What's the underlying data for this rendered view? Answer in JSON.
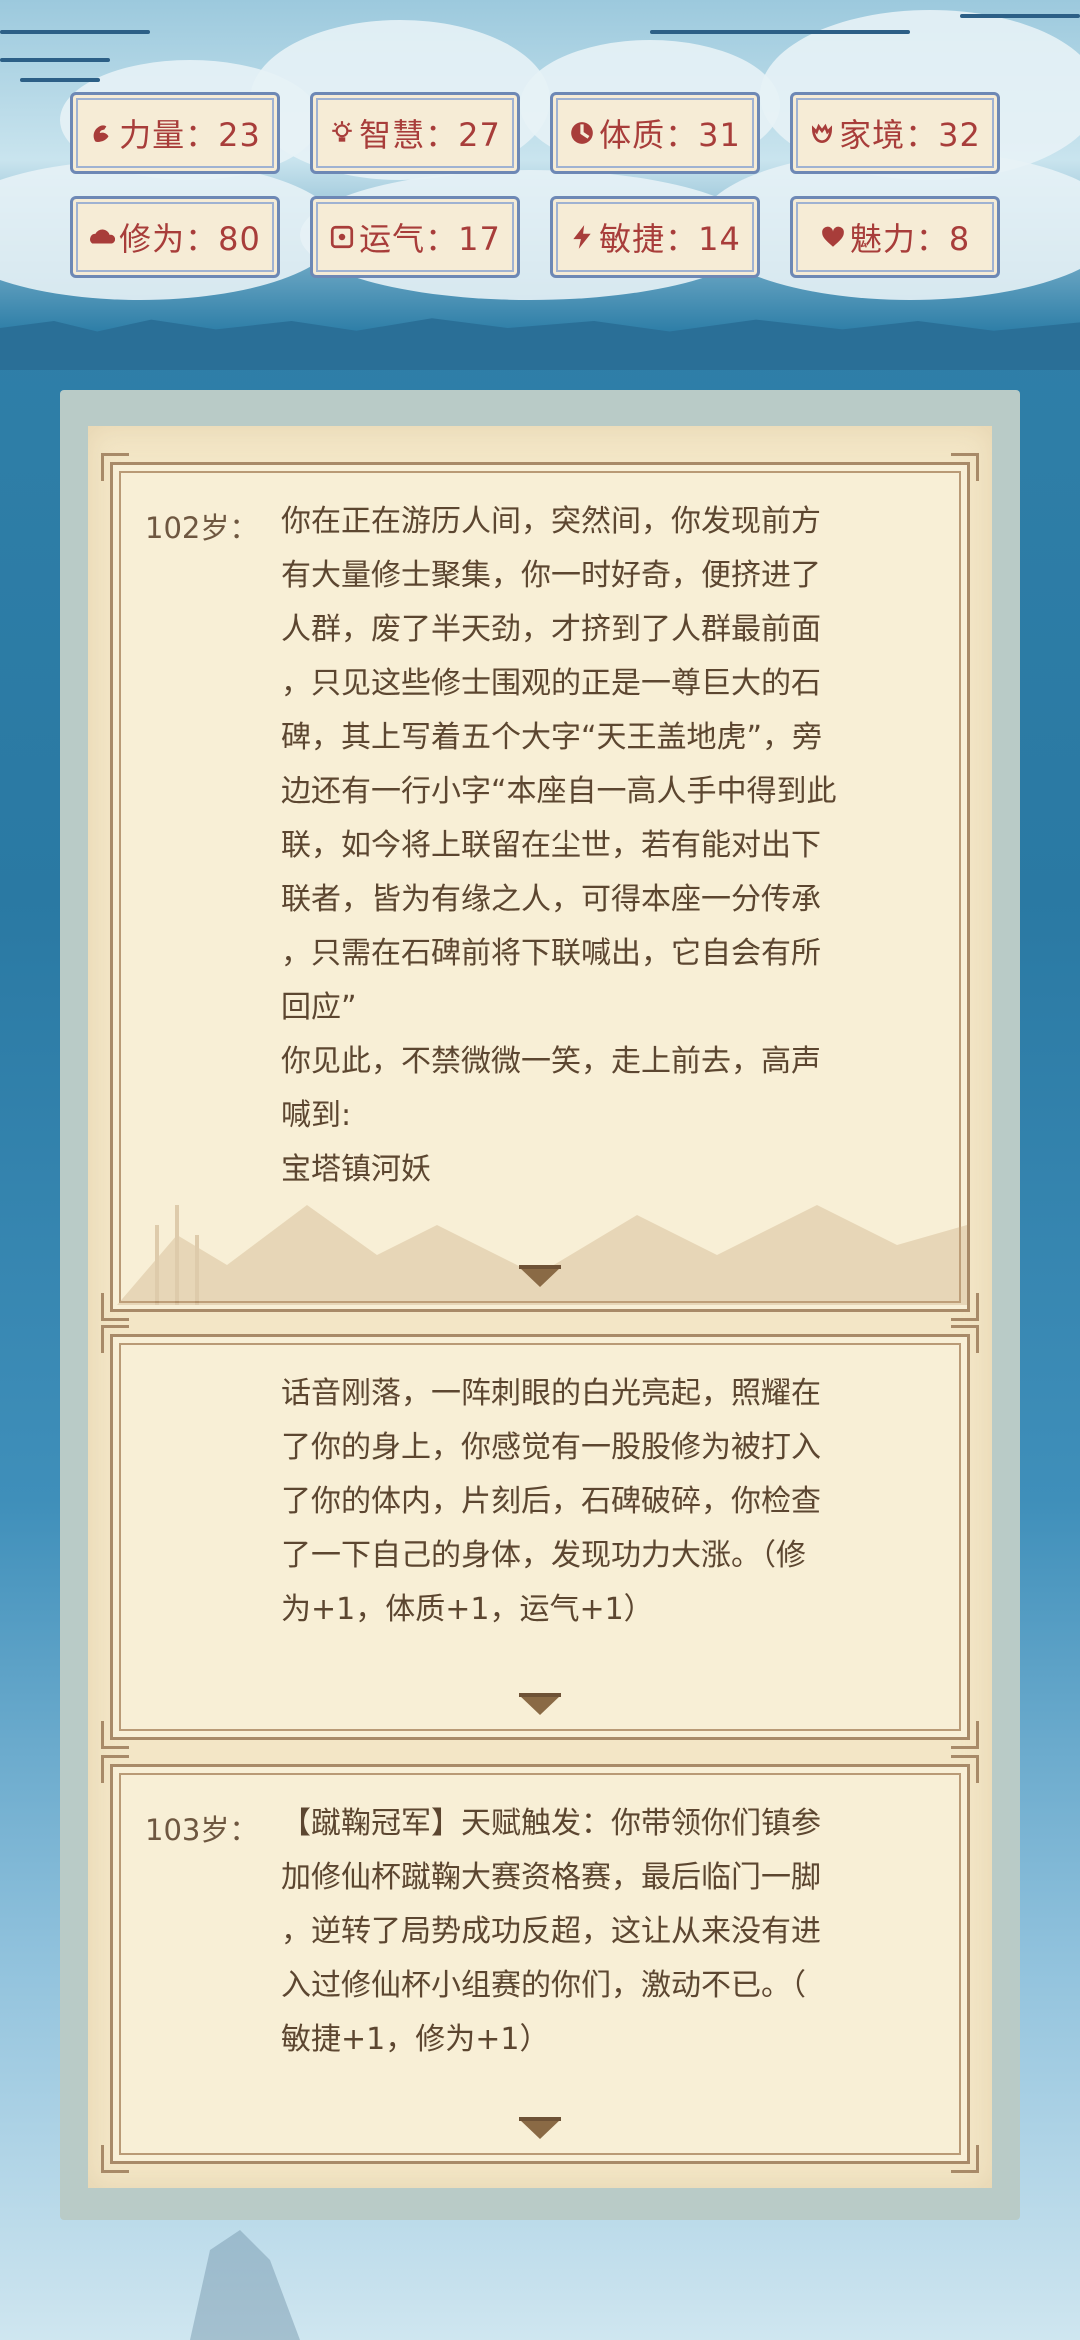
{
  "stats": [
    {
      "label": "力量：23",
      "icon": "strength-icon",
      "color": "#a83d3a"
    },
    {
      "label": "智慧：27",
      "icon": "wisdom-icon",
      "color": "#a83d3a"
    },
    {
      "label": "体质：31",
      "icon": "constitution-icon",
      "color": "#a83d3a"
    },
    {
      "label": "家境：32",
      "icon": "family-icon",
      "color": "#a83d3a"
    },
    {
      "label": "修为：80",
      "icon": "cultivation-icon",
      "color": "#a83d3a"
    },
    {
      "label": "运气：17",
      "icon": "luck-icon",
      "color": "#a83d3a"
    },
    {
      "label": "敏捷：14",
      "icon": "agility-icon",
      "color": "#a83d3a"
    },
    {
      "label": "魅力：8",
      "icon": "charm-icon",
      "color": "#a83d3a"
    }
  ],
  "events": [
    {
      "age": "102岁：",
      "text": "你在正在游历人间，突然间，你发现前方\n有大量修士聚集，你一时好奇，便挤进了\n人群，废了半天劲，才挤到了人群最前面\n，只见这些修士围观的正是一尊巨大的石\n碑，其上写着五个大字“天王盖地虎”，旁\n边还有一行小字“本座自一高人手中得到此\n联，如今将上联留在尘世，若有能对出下\n联者，皆为有缘之人，可得本座一分传承\n，只需在石碑前将下联喊出，它自会有所\n回应”\n你见此，不禁微微一笑，走上前去，高声\n喊到:\n宝塔镇河妖"
    },
    {
      "age": "",
      "text": "话音刚落，一阵刺眼的白光亮起，照耀在\n了你的身上，你感觉有一股股修为被打入\n了你的体内，片刻后，石碑破碎，你检查\n了一下自己的身体，发现功力大涨。（修\n为+1，体质+1，运气+1）"
    },
    {
      "age": "103岁：",
      "text": "【蹴鞠冠军】天赋触发：你带领你们镇参\n加修仙杯蹴鞠大赛资格赛，最后临门一脚\n，逆转了局势成功反超，这让从来没有进\n入过修仙杯小组赛的你们，激动不已。（\n敏捷+1，修为+1）"
    }
  ],
  "colors": {
    "stat_text": "#a83d3a",
    "card_text": "#5c4630",
    "card_border": "#a88a68",
    "stat_border": "#6d88b5"
  }
}
